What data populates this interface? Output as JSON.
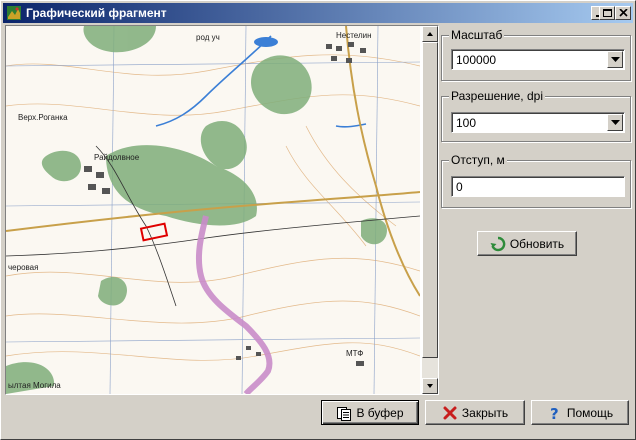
{
  "window": {
    "title": "Графический фрагмент",
    "controls": [
      "minimize",
      "maximize",
      "close"
    ]
  },
  "map": {
    "place_labels": [
      "Верх.Роганка",
      "Райдолвное",
      "Нестелин",
      "род уч",
      "МТФ",
      "черовая",
      "ылтая Могила"
    ],
    "selection_color": "#e00000"
  },
  "panel": {
    "scale": {
      "label": "Масштаб",
      "value": "100000"
    },
    "resolution": {
      "label": "Разрешение, dpi",
      "value": "100"
    },
    "offset": {
      "label": "Отступ, м",
      "value": "0"
    },
    "refresh_label": "Обновить"
  },
  "footer": {
    "copy_label": "В буфер",
    "close_label": "Закрыть",
    "help_label": "Помощь"
  },
  "colors": {
    "title_start": "#0a246a",
    "title_end": "#a6caf0",
    "forest": "#7fae7a",
    "water": "#3b7fd6",
    "road": "#c8a04a",
    "trail": "#c98cc9"
  }
}
